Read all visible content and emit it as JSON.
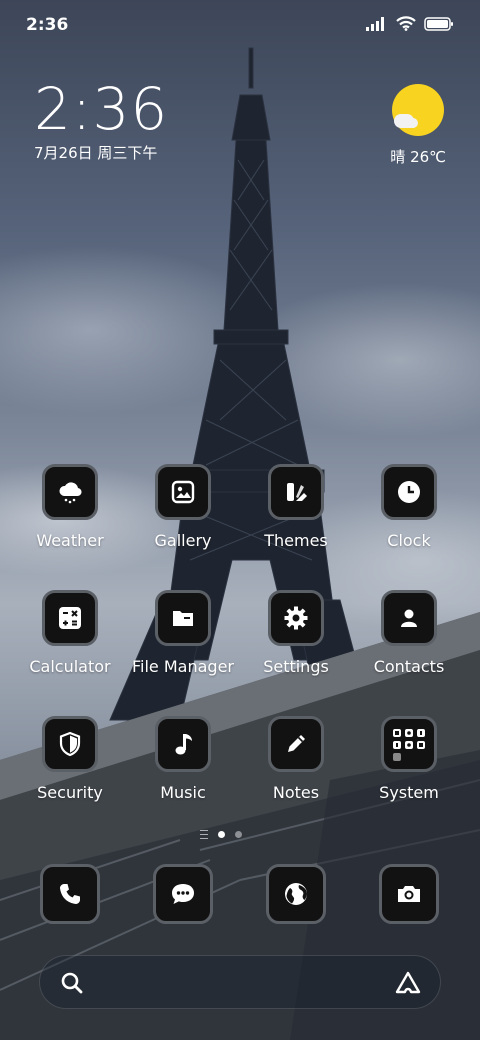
{
  "status_bar": {
    "time": "2:36",
    "signal_icon": "signal-icon",
    "wifi_icon": "wifi-icon",
    "battery_icon": "battery-icon"
  },
  "clock_widget": {
    "time": "2:36",
    "date": "7月26日 周三下午"
  },
  "weather_widget": {
    "icon": "sunny-cloud-icon",
    "condition_temp": "晴 26℃",
    "sun_color": "#f8d320"
  },
  "apps": [
    {
      "label": "Weather",
      "icon": "weather-icon"
    },
    {
      "label": "Gallery",
      "icon": "gallery-icon"
    },
    {
      "label": "Themes",
      "icon": "themes-icon"
    },
    {
      "label": "Clock",
      "icon": "clock-icon"
    },
    {
      "label": "Calculator",
      "icon": "calculator-icon"
    },
    {
      "label": "File Manager",
      "icon": "folder-icon"
    },
    {
      "label": "Settings",
      "icon": "gear-icon"
    },
    {
      "label": "Contacts",
      "icon": "contact-icon"
    },
    {
      "label": "Security",
      "icon": "shield-icon"
    },
    {
      "label": "Music",
      "icon": "music-note-icon"
    },
    {
      "label": "Notes",
      "icon": "pencil-icon"
    },
    {
      "label": "System",
      "icon": "folder-grid-icon"
    }
  ],
  "page_indicator": {
    "pages": 2,
    "active": 1
  },
  "dock": [
    {
      "icon": "phone-icon"
    },
    {
      "icon": "message-icon"
    },
    {
      "icon": "browser-globe-icon"
    },
    {
      "icon": "camera-icon"
    }
  ],
  "search_bar": {
    "left_icon": "search-icon",
    "right_icon": "assistant-icon"
  },
  "colors": {
    "icon_background": "#121212",
    "icon_border": "#5b5f66"
  }
}
